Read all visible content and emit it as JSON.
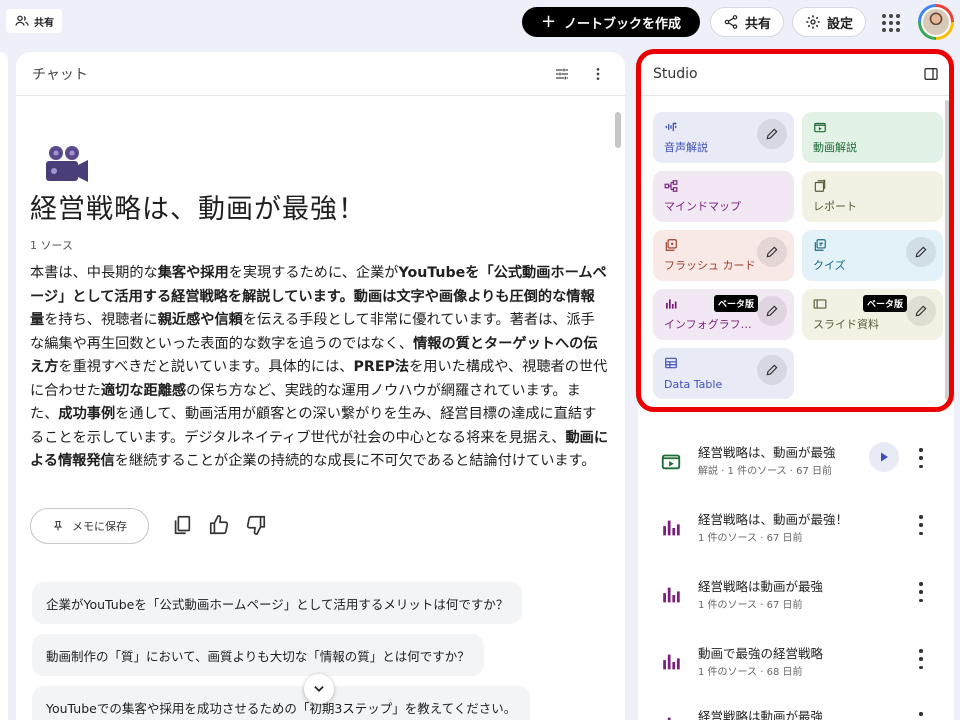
{
  "topbar": {
    "share_chip_label": "共有",
    "create_label": "ノートブックを作成",
    "share_label": "共有",
    "settings_label": "設定"
  },
  "chat": {
    "header_title": "チャット",
    "notebook_title": "経営戦略は、動画が最強！",
    "source_count": "1 ソース",
    "summary_segments": [
      {
        "text": "本書は、中長期的な",
        "bold": false
      },
      {
        "text": "集客や採用",
        "bold": true
      },
      {
        "text": "を実現するために、企業が",
        "bold": false
      },
      {
        "text": "YouTubeを「公式動画ホームページ」として活用する経営戦略を解説しています。",
        "bold": true
      },
      {
        "text": "動画は文字や画像よりも圧倒的な情報量",
        "bold": true
      },
      {
        "text": "を持ち、視聴者に",
        "bold": false
      },
      {
        "text": "親近感や信頼",
        "bold": true
      },
      {
        "text": "を伝える手段として非常に優れています。著者は、派手な編集や再生回数といった表面的な数字を追うのではなく、",
        "bold": false
      },
      {
        "text": "情報の質とターゲットへの伝え方",
        "bold": true
      },
      {
        "text": "を重視すべきだと説いています。具体的には、",
        "bold": false
      },
      {
        "text": "PREP法",
        "bold": true
      },
      {
        "text": "を用いた構成や、視聴者の世代に合わせた",
        "bold": false
      },
      {
        "text": "適切な距離感",
        "bold": true
      },
      {
        "text": "の保ち方など、実践的な運用ノウハウが網羅されています。また、",
        "bold": false
      },
      {
        "text": "成功事例",
        "bold": true
      },
      {
        "text": "を通して、動画活用が顧客との深い繋がりを生み、経営目標の達成に直結することを示しています。デジタルネイティブ世代が社会の中心となる将来を見据え、",
        "bold": false
      },
      {
        "text": "動画による情報発信",
        "bold": true
      },
      {
        "text": "を継続することが企業の持続的な成長に不可欠であると結論付けています。",
        "bold": false
      }
    ],
    "save_note_label": "メモに保存",
    "suggestions": [
      "企業がYouTubeを「公式動画ホームページ」として活用するメリットは何ですか？",
      "動画制作の「質」において、画質よりも大切な「情報の質」とは何ですか？",
      "YouTubeでの集客や採用を成功させるための「初期3ステップ」を教えてください。"
    ]
  },
  "studio": {
    "header_title": "Studio",
    "tiles": [
      {
        "label": "音声解説",
        "icon": "audio-waveform-icon",
        "bg": "#e8eaf6",
        "fg": "#3f51b5",
        "edit": true,
        "beta": false
      },
      {
        "label": "動画解説",
        "icon": "video-icon",
        "bg": "#e2f2e6",
        "fg": "#1e6b35",
        "edit": false,
        "beta": false
      },
      {
        "label": "マインドマップ",
        "icon": "mindmap-icon",
        "bg": "#f2e8f3",
        "fg": "#7b1f7e",
        "edit": false,
        "beta": false
      },
      {
        "label": "レポート",
        "icon": "report-icon",
        "bg": "#f3f1e4",
        "fg": "#5d5a3a",
        "edit": false,
        "beta": false
      },
      {
        "label": "フラッシュ カード",
        "icon": "flashcard-icon",
        "bg": "#f8e9e6",
        "fg": "#9c3d2b",
        "edit": true,
        "beta": false
      },
      {
        "label": "クイズ",
        "icon": "quiz-icon",
        "bg": "#e3f2f8",
        "fg": "#1a6a85",
        "edit": true,
        "beta": false
      },
      {
        "label": "インフォグラフ…",
        "icon": "infographic-icon",
        "bg": "#f2e8f3",
        "fg": "#7b1f7e",
        "edit": true,
        "beta": true
      },
      {
        "label": "スライド資料",
        "icon": "slides-icon",
        "bg": "#f3f1e4",
        "fg": "#5d5a3a",
        "edit": true,
        "beta": true
      },
      {
        "label": "Data Table",
        "icon": "table-icon",
        "bg": "#e8eaf6",
        "fg": "#3f51b5",
        "edit": true,
        "beta": false
      }
    ],
    "beta_label": "ベータ版",
    "items": [
      {
        "title": "経営戦略は、動画が最強",
        "sub": "解説 · 1 件のソース · 67 日前",
        "icon": "video-icon",
        "play": true
      },
      {
        "title": "経営戦略は、動画が最強！",
        "sub": "1 件のソース · 67 日前",
        "icon": "infographic-icon",
        "play": false
      },
      {
        "title": "経営戦略は動画が最強",
        "sub": "1 件のソース · 67 日前",
        "icon": "infographic-icon",
        "play": false
      },
      {
        "title": "動画で最強の経営戦略",
        "sub": "1 件のソース · 68 日前",
        "icon": "infographic-icon",
        "play": false
      },
      {
        "title": "経営戦略は動画が最強",
        "sub": "",
        "icon": "infographic-icon",
        "play": false
      }
    ]
  },
  "colors": {
    "highlight_border": "#ea0000",
    "background": "#eef0f9"
  }
}
